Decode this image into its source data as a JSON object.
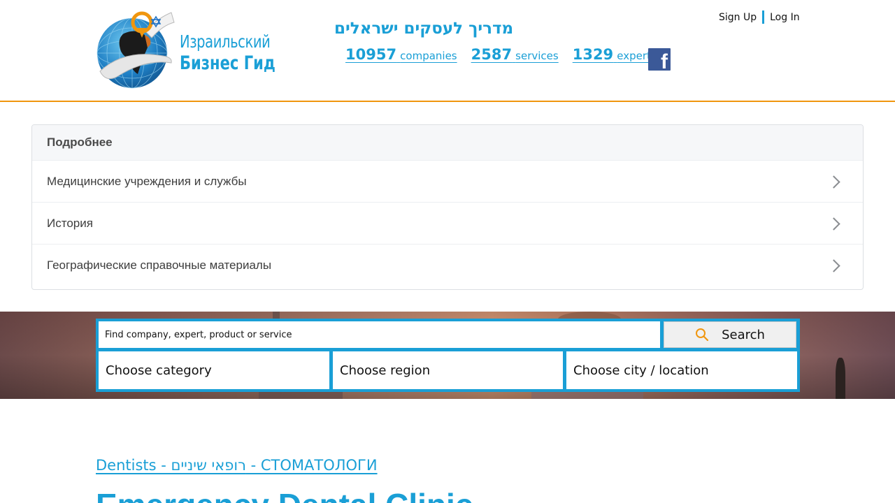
{
  "header": {
    "logo": {
      "line1": "Израильский",
      "line2": "Бизнес Гид",
      "icon": "globe-logo-icon"
    },
    "tagline": "מדריך לעסקים ישראלים",
    "stats": [
      {
        "number": "10957",
        "label": "companies"
      },
      {
        "number": "2587",
        "label": "services"
      },
      {
        "number": "1329",
        "label": "experts"
      }
    ],
    "social_icon": "facebook-icon",
    "auth": {
      "signup_label": "Sign Up",
      "login_label": "Log In"
    }
  },
  "panel": {
    "title": "Подробнее",
    "items": [
      {
        "label": "Медицинские учреждения и службы"
      },
      {
        "label": "История"
      },
      {
        "label": "Географические справочные материалы"
      }
    ]
  },
  "search": {
    "placeholder": "Find company, expert, product or service",
    "button_label": "Search",
    "category_label": "Choose category",
    "region_label": "Choose region",
    "city_label": "Choose city / location"
  },
  "content": {
    "category_link": "Dentists - רופאי שיניים - СТОМАТОЛОГИ",
    "title": "Emergency Dental Clinic"
  },
  "colors": {
    "accent": "#1a9fd6",
    "header_border": "#f0960e",
    "facebook": "#3b5998"
  }
}
